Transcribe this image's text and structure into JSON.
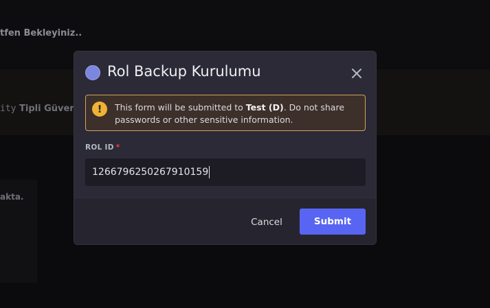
{
  "background": {
    "wait_text": "tfen Bekleyiniz..",
    "line_mono": "ity",
    "line_text": "Tipli Güver",
    "panel_text": "akta."
  },
  "modal": {
    "title": "Rol Backup Kurulumu",
    "avatar_color": "#7b86de",
    "close_icon": "close-icon",
    "warning": {
      "icon": "exclamation-icon",
      "text_before": "This form will be submitted to ",
      "target": "Test (D)",
      "text_after": ". Do not share passwords or other sensitive information."
    },
    "field": {
      "label": "ROL ID",
      "required_mark": "*",
      "value": "1266796250267910159"
    },
    "buttons": {
      "cancel": "Cancel",
      "submit": "Submit"
    },
    "accent_color": "#5865f2"
  }
}
